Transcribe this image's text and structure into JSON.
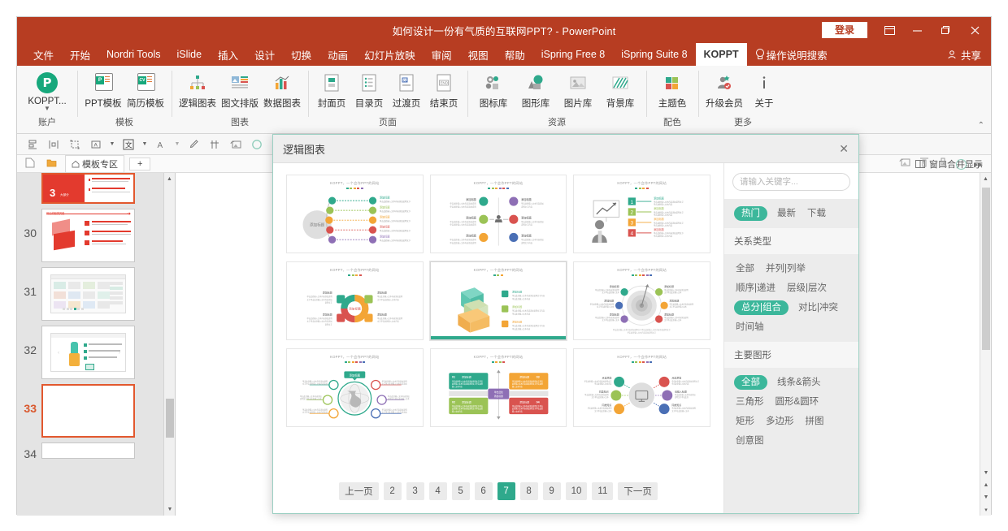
{
  "window": {
    "title": "如何设计一份有气质的互联网PPT?  -  PowerPoint",
    "login_label": "登录",
    "restore_icon": "ribbon-display-options-icon",
    "minimize_icon": "minimize-icon",
    "maximize_icon": "restore-icon",
    "close_icon": "close-icon"
  },
  "tabs": [
    {
      "label": "文件",
      "active": false
    },
    {
      "label": "开始",
      "active": false
    },
    {
      "label": "Nordri Tools",
      "active": false
    },
    {
      "label": "iSlide",
      "active": false
    },
    {
      "label": "插入",
      "active": false
    },
    {
      "label": "设计",
      "active": false
    },
    {
      "label": "切换",
      "active": false
    },
    {
      "label": "动画",
      "active": false
    },
    {
      "label": "幻灯片放映",
      "active": false
    },
    {
      "label": "审阅",
      "active": false
    },
    {
      "label": "视图",
      "active": false
    },
    {
      "label": "帮助",
      "active": false
    },
    {
      "label": "iSpring Free 8",
      "active": false
    },
    {
      "label": "iSpring Suite 8",
      "active": false
    },
    {
      "label": "KOPPT",
      "active": true
    }
  ],
  "tell_me": "操作说明搜索",
  "share": "共享",
  "ribbon": {
    "groups": [
      {
        "label": "账户",
        "items": [
          {
            "label": "KOPPT...",
            "icon": "koppt-logo-icon",
            "caret": true
          }
        ]
      },
      {
        "label": "模板",
        "items": [
          {
            "label": "PPT模板",
            "icon": "ppt-template-icon"
          },
          {
            "label": "简历模板",
            "icon": "resume-template-icon"
          }
        ]
      },
      {
        "label": "图表",
        "items": [
          {
            "label": "逻辑图表",
            "icon": "logic-chart-icon"
          },
          {
            "label": "图文排版",
            "icon": "text-image-layout-icon"
          },
          {
            "label": "数据图表",
            "icon": "data-chart-icon"
          }
        ]
      },
      {
        "label": "页面",
        "items": [
          {
            "label": "封面页",
            "icon": "cover-page-icon"
          },
          {
            "label": "目录页",
            "icon": "toc-page-icon"
          },
          {
            "label": "过渡页",
            "icon": "transition-page-icon"
          },
          {
            "label": "结束页",
            "icon": "end-page-icon"
          }
        ]
      },
      {
        "label": "资源",
        "items": [
          {
            "label": "图标库",
            "icon": "icon-library-icon"
          },
          {
            "label": "图形库",
            "icon": "shape-library-icon"
          },
          {
            "label": "图片库",
            "icon": "image-library-icon"
          },
          {
            "label": "背景库",
            "icon": "background-library-icon"
          }
        ]
      },
      {
        "label": "配色",
        "items": [
          {
            "label": "主题色",
            "icon": "theme-color-icon"
          }
        ]
      },
      {
        "label": "更多",
        "items": [
          {
            "label": "升级会员",
            "icon": "upgrade-member-icon"
          },
          {
            "label": "关于",
            "icon": "about-info-icon"
          }
        ]
      }
    ]
  },
  "quick_toolbar": {
    "icons": [
      "align-icon",
      "distribute-icon",
      "crop-select-icon",
      "text-box-icon",
      "text-style-icon",
      "font-color-icon",
      "eyedropper-icon",
      "pin-icon",
      "image-swap-icon",
      "circle-shape-icon",
      "color-swatch-icon"
    ]
  },
  "template_tabs": {
    "new_file_icon": "new-file-icon",
    "open-folder_icon": "open-folder-icon",
    "home_icon": "home-icon",
    "tab_label": "模板专区",
    "add_label": "+",
    "window_merge_label": "窗口合并显示",
    "window_merge_icon": "window-merge-icon"
  },
  "slide_pane": {
    "slides": [
      {
        "number": "",
        "selected": false,
        "style": "red-cover"
      },
      {
        "number": "30",
        "selected": false,
        "style": "red-3d"
      },
      {
        "number": "31",
        "selected": false,
        "style": "ui-grid"
      },
      {
        "number": "32",
        "selected": false,
        "style": "ui-carousel"
      },
      {
        "number": "33",
        "selected": true,
        "style": "blank"
      },
      {
        "number": "34",
        "selected": false,
        "style": "blank"
      }
    ]
  },
  "modal": {
    "title": "逻辑图表",
    "close_icon": "close-icon",
    "thumbnails": [
      {
        "name": "fan-list-5-items",
        "thumb_title": "KOPPT，一个会作PPT的网站",
        "accents": [
          "#2fa98c",
          "#9bc356",
          "#f3a536",
          "#d9534f",
          "#8e6fb5"
        ]
      },
      {
        "name": "two-column-6-items",
        "thumb_title": "KOPPT，一个会作PPT的网站",
        "accents": [
          "#2fa98c",
          "#9bc356",
          "#f3a536",
          "#8e6fb5",
          "#d9534f",
          "#4a6fb5"
        ]
      },
      {
        "name": "numbered-4-steps-presenter",
        "thumb_title": "KOPPT，一个会作PPT的网站",
        "accents": [
          "#2fa98c",
          "#9bc356",
          "#f3a536",
          "#d9534f"
        ]
      },
      {
        "name": "donut-4-quadrant",
        "thumb_title": "KOPPT，一个会作PPT的网站",
        "accents": [
          "#2fa98c",
          "#9bc356",
          "#f3a536",
          "#d9534f"
        ]
      },
      {
        "name": "stacked-3d-blocks-3-items",
        "thumb_title": "KOPPT，一个会作PPT的网站",
        "accents": [
          "#2fa98c",
          "#9bc356",
          "#f3a536"
        ],
        "selected": true
      },
      {
        "name": "target-radial-6-items",
        "thumb_title": "KOPPT，一个会作PPT的网站",
        "accents": [
          "#2fa98c",
          "#9bc356",
          "#f3a536",
          "#d9534f",
          "#8e6fb5",
          "#4a6fb5"
        ]
      },
      {
        "name": "globe-radial-6-items",
        "thumb_title": "KOPPT，一个会作PPT的网站",
        "accents": [
          "#2fa98c",
          "#9bc356",
          "#f3a536",
          "#d9534f",
          "#8e6fb5",
          "#4a6fb5"
        ]
      },
      {
        "name": "four-quadrant-cards",
        "thumb_title": "KOPPT，一个会作PPT的网站",
        "accents": [
          "#2fa98c",
          "#f3a536",
          "#9bc356",
          "#d9534f"
        ],
        "labels": [
          "01",
          "02",
          "03",
          "04"
        ]
      },
      {
        "name": "monitor-radial-6-items",
        "thumb_title": "KOPPT，一个会作PPT的网站",
        "accents": [
          "#2fa98c",
          "#9bc356",
          "#f3a536",
          "#d9534f",
          "#8e6fb5",
          "#4a6fb5"
        ]
      }
    ],
    "pager": [
      {
        "label": "上一页",
        "active": false
      },
      {
        "label": "2",
        "active": false
      },
      {
        "label": "3",
        "active": false
      },
      {
        "label": "4",
        "active": false
      },
      {
        "label": "5",
        "active": false
      },
      {
        "label": "6",
        "active": false
      },
      {
        "label": "7",
        "active": true
      },
      {
        "label": "8",
        "active": false
      },
      {
        "label": "9",
        "active": false
      },
      {
        "label": "10",
        "active": false
      },
      {
        "label": "11",
        "active": false
      },
      {
        "label": "下一页",
        "active": false
      }
    ],
    "search": {
      "placeholder": "请输入关键字...",
      "value": "",
      "icon": "search-icon"
    },
    "sort_tags": [
      {
        "label": "热门",
        "on": true
      },
      {
        "label": "最新",
        "on": false
      },
      {
        "label": "下载",
        "on": false
      }
    ],
    "sections": [
      {
        "title": "关系类型",
        "tags": [
          {
            "label": "全部",
            "on": false
          },
          {
            "label": "并列|列举",
            "on": false
          },
          {
            "label": "顺序|递进",
            "on": false
          },
          {
            "label": "层级|层次",
            "on": false
          },
          {
            "label": "总分|组合",
            "on": true
          },
          {
            "label": "对比|冲突",
            "on": false
          },
          {
            "label": "时间轴",
            "on": false
          }
        ]
      },
      {
        "title": "主要图形",
        "tags": [
          {
            "label": "全部",
            "on": true
          },
          {
            "label": "线条&箭头",
            "on": false
          },
          {
            "label": "三角形",
            "on": false
          },
          {
            "label": "圆形&圆环",
            "on": false
          },
          {
            "label": "矩形",
            "on": false
          },
          {
            "label": "多边形",
            "on": false
          },
          {
            "label": "拼图",
            "on": false
          },
          {
            "label": "创意图",
            "on": false
          }
        ]
      }
    ]
  },
  "float_toolbar": {
    "icons": [
      "image-replace-icon",
      "align-top-icon",
      "align-bottom-icon",
      "circle-shape-icon",
      "more-icon"
    ]
  },
  "colors": {
    "brand_red": "#b73d22",
    "accent_teal": "#2fa98c",
    "tag_teal": "#3cb79b",
    "slide_select": "#e2582e"
  }
}
